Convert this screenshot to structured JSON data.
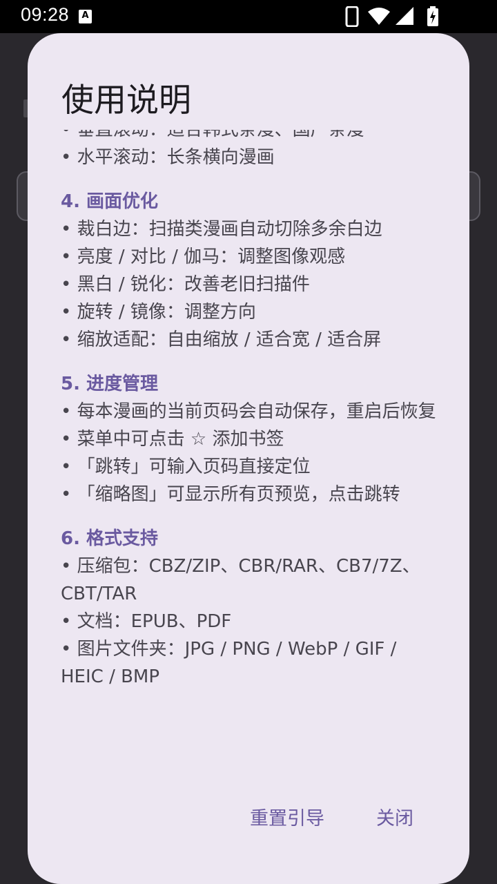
{
  "status_bar": {
    "time": "09:28",
    "notification_icon": "A",
    "icons": [
      "phone-icon",
      "wifi-icon",
      "signal-icon",
      "battery-charging-icon"
    ]
  },
  "dialog": {
    "title": "使用说明",
    "partial_top_line": "• 垂直滚动：适合韩式条漫、国产条漫",
    "sections": [
      {
        "heading": null,
        "lines": [
          "• 水平滚动：长条横向漫画"
        ]
      },
      {
        "heading": "4. 画面优化",
        "lines": [
          "• 裁白边：扫描类漫画自动切除多余白边",
          "• 亮度 / 对比 / 伽马：调整图像观感",
          "• 黑白 / 锐化：改善老旧扫描件",
          "• 旋转 / 镜像：调整方向",
          "• 缩放适配：自由缩放 / 适合宽 / 适合屏"
        ]
      },
      {
        "heading": "5. 进度管理",
        "lines": [
          "• 每本漫画的当前页码会自动保存，重启后恢复",
          "• 菜单中可点击 ☆ 添加书签",
          "• 「跳转」可输入页码直接定位",
          "• 「缩略图」可显示所有页预览，点击跳转"
        ]
      },
      {
        "heading": "6. 格式支持",
        "lines": [
          "• 压缩包：CBZ/ZIP、CBR/RAR、CB7/7Z、CBT/TAR",
          "• 文档：EPUB、PDF",
          "• 图片文件夹：JPG / PNG / WebP / GIF / HEIC / BMP"
        ]
      }
    ],
    "buttons": {
      "reset_label": "重置引导",
      "close_label": "关闭"
    }
  },
  "colors": {
    "dialog_background": "#ede7f2",
    "accent": "#6a5aa0",
    "body_text": "#48454e",
    "title_text": "#1d1b20"
  }
}
